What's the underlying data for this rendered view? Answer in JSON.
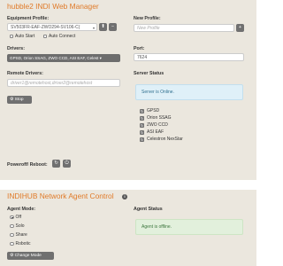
{
  "indi": {
    "title": "hubble2 INDI Web Manager",
    "equipment_profile_label": "Equipment Profile:",
    "equipment_profile_value": "SV503FR-EAF-ZWO294-SV106-C(",
    "auto_start_label": "Auto Start",
    "auto_connect_label": "Auto Connect",
    "new_profile_label": "New Profile:",
    "new_profile_placeholder": "New Profile",
    "port_label": "Port:",
    "port_value": "7624",
    "drivers_label": "Drivers:",
    "drivers_value": "GPSD, Orion SSAG, ZWO CCD, ASI EAF, Celest ▾",
    "remote_drivers_label": "Remote Drivers:",
    "remote_drivers_placeholder": "driver1@remotehost,driver2@remotehost",
    "stop_label": "Stop",
    "server_status_label": "Server Status",
    "server_status_text": "Server is Online.",
    "running_drivers": [
      "GPSD",
      "Orion SSAG",
      "ZWO CCD",
      "ASI EAF",
      "Celestron NexStar"
    ],
    "poweroff_reboot_label": "Poweroff/ Reboot:"
  },
  "indihub": {
    "title": "INDIHUB Network Agent Control",
    "agent_mode_label": "Agent Mode:",
    "modes": [
      "Off",
      "Solo",
      "Share",
      "Robotic"
    ],
    "selected_mode": "Off",
    "change_mode_label": "Change Mode",
    "agent_status_label": "Agent Status",
    "agent_status_text": "Agent is offline."
  },
  "colors": {
    "accent": "#e07b2a",
    "panel": "#ebe7de",
    "button": "#707070"
  }
}
